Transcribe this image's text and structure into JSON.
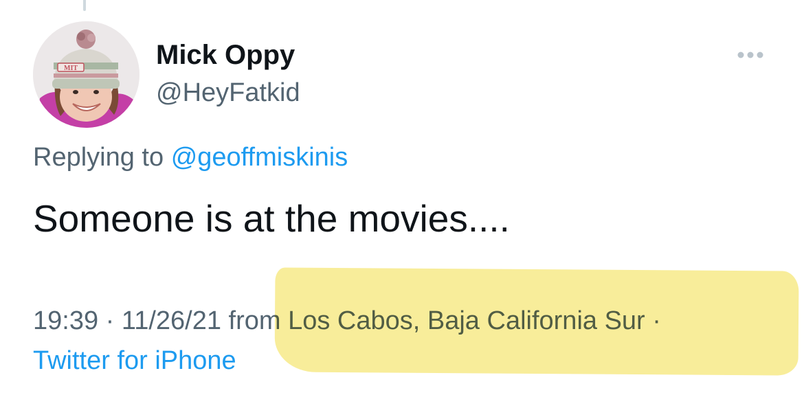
{
  "author": {
    "name": "Mick Oppy",
    "handle": "@HeyFatkid",
    "avatar_hat_text": "MIT"
  },
  "reply": {
    "prefix": "Replying to",
    "to": "@geoffmiskinis"
  },
  "tweet": {
    "text": "Someone is at the movies...."
  },
  "meta": {
    "time": "19:39",
    "sep1": " · ",
    "date": "11/26/21",
    "location_text": " from Los Cabos, Baja California Sur",
    "sep2": " ·",
    "source": "Twitter for iPhone"
  },
  "icons": {
    "more": "more-horizontal-icon"
  },
  "colors": {
    "primary_text": "#0f1419",
    "secondary_text": "#536471",
    "link": "#1d9bf0",
    "highlight": "#f6e87d"
  }
}
